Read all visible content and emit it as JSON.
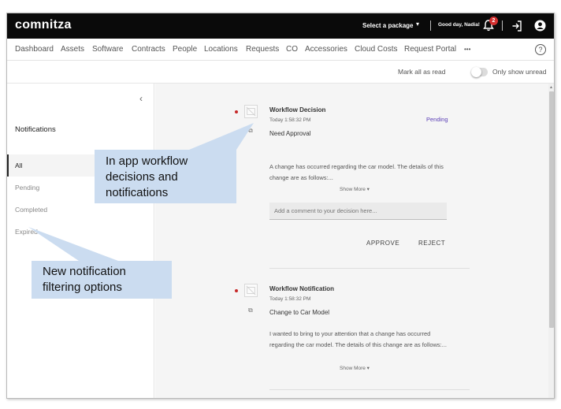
{
  "app": {
    "logo": "comnitza",
    "select_package": "Select a package",
    "greeting": "Good day, Nadia!",
    "notification_count": "2"
  },
  "nav": {
    "items": [
      "Dashboard",
      "Assets",
      "Software",
      "Contracts",
      "People",
      "Locations",
      "Requests",
      "CO",
      "Accessories",
      "Cloud Costs",
      "Request Portal"
    ],
    "more": "•••",
    "help": "?"
  },
  "actions": {
    "mark_all": "Mark all as read",
    "only_unread": "Only show unread"
  },
  "sidebar": {
    "title": "Notifications",
    "filters": [
      "All",
      "Pending",
      "Completed",
      "Expired"
    ],
    "collapse": "‹"
  },
  "notifications": [
    {
      "type": "Workflow Decision",
      "time": "Today 1:58:32 PM",
      "subject": "Need Approval",
      "status": "Pending",
      "body": "A change has occurred regarding the car model. The details of this change are as follows:...",
      "show_more": "Show More",
      "comment_placeholder": "Add a comment to your decision here...",
      "approve": "APPROVE",
      "reject": "REJECT"
    },
    {
      "type": "Workflow Notification",
      "time": "Today 1:58:32 PM",
      "subject": "Change to Car Model",
      "body": "I wanted to bring to your attention that a change has occurred regarding the car model. The details of this change are as follows:...",
      "show_more": "Show More"
    }
  ],
  "callouts": {
    "workflow": "In app workflow decisions and notifications",
    "filtering": "New notification filtering options"
  },
  "colors": {
    "topbar": "#0a0a0a",
    "badge": "#d32f2f",
    "status": "#5b3fb6",
    "callout": "#cbdcf0",
    "unread_dot": "#c62828"
  }
}
